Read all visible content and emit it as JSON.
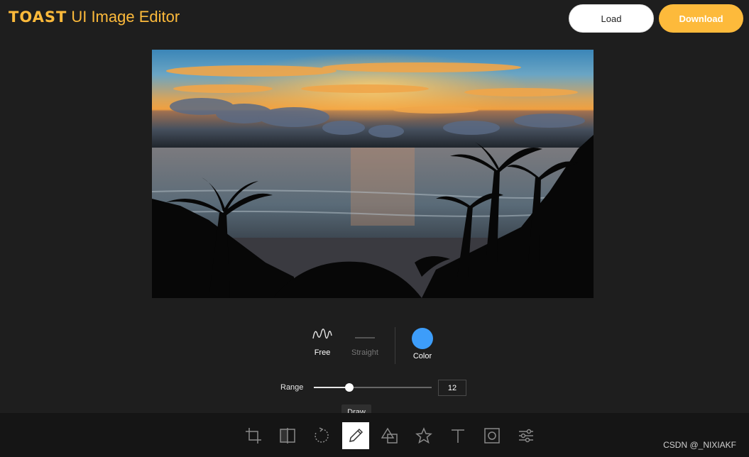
{
  "header": {
    "logo_strong": "TOAST",
    "logo_rest": "UI Image Editor",
    "load_label": "Load",
    "download_label": "Download"
  },
  "draw_submenu": {
    "free_label": "Free",
    "straight_label": "Straight",
    "color_label": "Color",
    "color_value": "#3d9dfa",
    "selected": "Free"
  },
  "range": {
    "label": "Range",
    "value": "12",
    "fraction": 0.3
  },
  "tooltip": {
    "text": "Draw"
  },
  "toolbar": {
    "items": [
      {
        "name": "crop",
        "icon": "crop-icon"
      },
      {
        "name": "flip",
        "icon": "flip-icon"
      },
      {
        "name": "rotate",
        "icon": "rotate-icon"
      },
      {
        "name": "draw",
        "icon": "pencil-icon",
        "active": true
      },
      {
        "name": "shape",
        "icon": "shape-icon"
      },
      {
        "name": "icon",
        "icon": "star-icon"
      },
      {
        "name": "text",
        "icon": "text-icon"
      },
      {
        "name": "mask",
        "icon": "mask-icon"
      },
      {
        "name": "filter",
        "icon": "filter-icon"
      }
    ]
  },
  "watermark": "CSDN @_NIXIAKF",
  "colors": {
    "accent": "#fdba3b",
    "background": "#1e1e1e",
    "toolbar_bg": "#151515"
  }
}
